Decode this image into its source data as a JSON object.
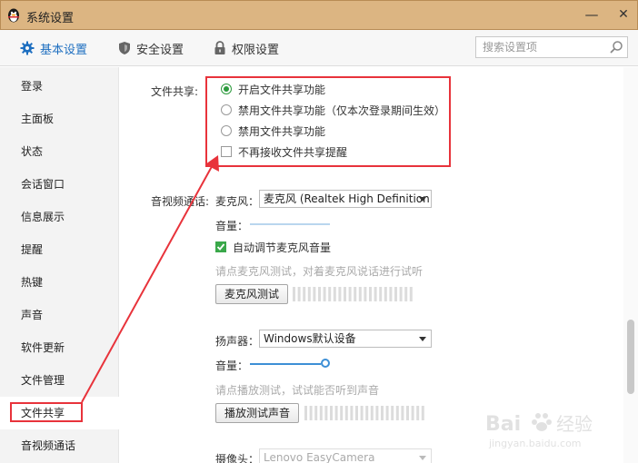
{
  "window": {
    "title": "系统设置",
    "minimize": "—",
    "close": "✕"
  },
  "tabs": [
    {
      "label": "基本设置",
      "icon": "gear-icon",
      "active": true
    },
    {
      "label": "安全设置",
      "icon": "shield-icon",
      "active": false
    },
    {
      "label": "权限设置",
      "icon": "lock-icon",
      "active": false
    }
  ],
  "search": {
    "placeholder": "搜索设置项"
  },
  "sidebar": {
    "items": [
      {
        "label": "登录"
      },
      {
        "label": "主面板"
      },
      {
        "label": "状态"
      },
      {
        "label": "会话窗口"
      },
      {
        "label": "信息展示"
      },
      {
        "label": "提醒"
      },
      {
        "label": "热键"
      },
      {
        "label": "声音"
      },
      {
        "label": "软件更新"
      },
      {
        "label": "文件管理"
      },
      {
        "label": "文件共享",
        "active": true
      },
      {
        "label": "音视频通话"
      }
    ]
  },
  "file_share": {
    "label": "文件共享:",
    "options": [
      {
        "label": "开启文件共享功能",
        "selected": true
      },
      {
        "label": "禁用文件共享功能（仅本次登录期间生效）",
        "selected": false
      },
      {
        "label": "禁用文件共享功能",
        "selected": false
      }
    ],
    "no_reminder": {
      "label": "不再接收文件共享提醒",
      "checked": false
    }
  },
  "av_call": {
    "label": "音视频通话:",
    "microphone": {
      "label": "麦克风：",
      "value": "麦克风 (Realtek High Definition ...",
      "volume_label": "音量：",
      "auto_adjust": {
        "label": "自动调节麦克风音量",
        "checked": true
      },
      "hint": "请点麦克风测试，对着麦克风说话进行试听",
      "test_button": "麦克风测试"
    },
    "speaker": {
      "label": "扬声器：",
      "value": "Windows默认设备",
      "volume_label": "音量：",
      "volume_level": 1.0,
      "hint": "请点播放测试，试试能否听到声音",
      "test_button": "播放测试声音"
    },
    "camera": {
      "label": "摄像头：",
      "value": "Lenovo EasyCamera"
    }
  },
  "colors": {
    "accent": "#1e6fc0",
    "title_bar": "#dcb582",
    "annotation": "#e8333b",
    "check_green": "#3aa84a"
  },
  "watermark": {
    "brand": "Bai",
    "brand_cn": "经验",
    "url": "jingyan.baidu.com"
  }
}
